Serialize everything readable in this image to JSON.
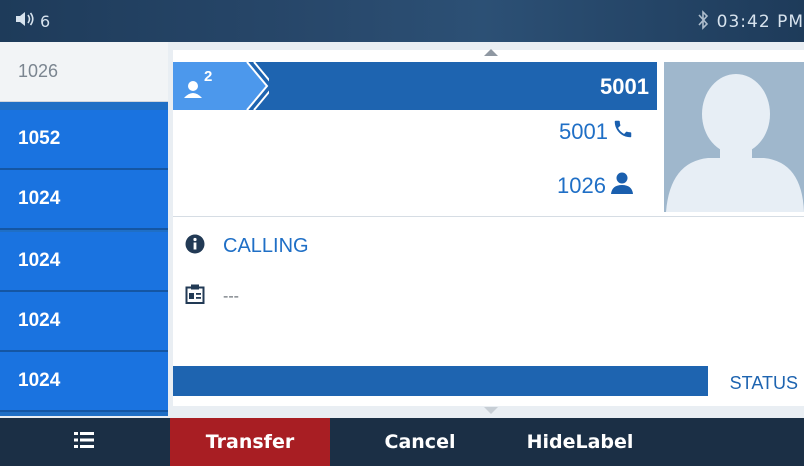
{
  "status_bar": {
    "volume_icon": "speaker-icon",
    "line_count": "6",
    "bluetooth_icon": "bluetooth-icon",
    "time": "03:42 PM"
  },
  "sidebar": {
    "items": [
      {
        "label": "1026",
        "active": true
      },
      {
        "label": "1052",
        "active": false
      },
      {
        "label": "1024",
        "active": false
      },
      {
        "label": "1024",
        "active": false
      },
      {
        "label": "1024",
        "active": false
      },
      {
        "label": "1024",
        "active": false
      }
    ]
  },
  "call": {
    "conference_count": "2",
    "header_number": "5001",
    "remote_number": "5001",
    "local_account": "1026",
    "state": "CALLING",
    "label_value": "---",
    "status_label": "STATUS"
  },
  "softkeys": {
    "menu_icon": "menu-list-icon",
    "transfer": "Transfer",
    "cancel": "Cancel",
    "hidelabel": "HideLabel"
  },
  "colors": {
    "accent_blue": "#1a73e0",
    "header_blue": "#1e64b0",
    "transfer_red": "#a81e23",
    "dark_navy": "#1b2f45"
  }
}
